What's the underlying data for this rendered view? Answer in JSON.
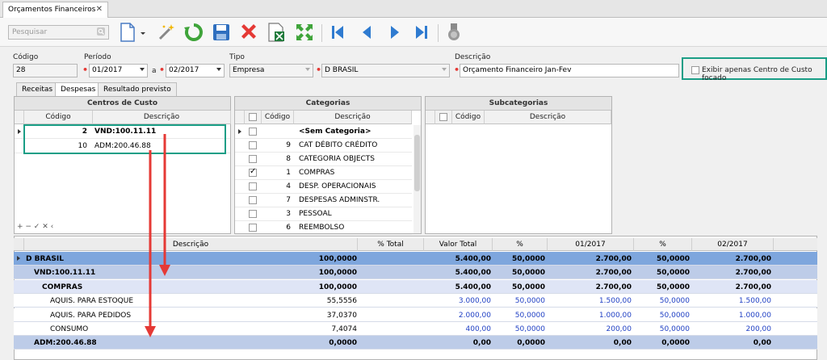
{
  "colors": {
    "accent_highlight": "#1a9e86",
    "arrow": "#e53935",
    "group1_row": "#7ea6dd",
    "group2_row": "#bdcce8",
    "group3_row": "#dfe5f6",
    "blue_values": "#1f3fc4"
  },
  "tab": {
    "title": "Orçamentos Financeiros",
    "close": "✕"
  },
  "toolbar": {
    "search_placeholder": "Pesquisar",
    "icons": [
      "search-icon",
      "new-document-icon",
      "dropdown-arrow-icon",
      "magic-wand-icon",
      "refresh-icon",
      "save-icon",
      "delete-icon",
      "export-excel-icon",
      "expand-icon",
      "first-record-icon",
      "previous-record-icon",
      "next-record-icon",
      "last-record-icon",
      "medal-icon"
    ]
  },
  "form": {
    "codigo": {
      "label": "Código",
      "value": "28"
    },
    "periodo": {
      "label": "Período",
      "from": "01/2017",
      "separator": "a",
      "to": "02/2017"
    },
    "tipo": {
      "label": "Tipo",
      "value": "Empresa"
    },
    "empresa": {
      "value": "D BRASIL"
    },
    "descricao": {
      "label": "Descrição",
      "value": "Orçamento Financeiro Jan-Fev"
    },
    "focus_checkbox": {
      "label": "Exibir apenas Centro de Custo focado",
      "checked": false
    }
  },
  "subtabs": [
    {
      "label": "Receitas",
      "active": false
    },
    {
      "label": "Despesas",
      "active": true
    },
    {
      "label": "Resultado previsto",
      "active": false
    }
  ],
  "centros": {
    "title": "Centros de Custo",
    "headers": [
      "Código",
      "Descrição"
    ],
    "rows": [
      {
        "codigo": "2",
        "descricao": "VND:100.11.11"
      },
      {
        "codigo": "10",
        "descricao": "ADM:200.46.88"
      }
    ],
    "footer": "+ − ✓ ✕ ‹"
  },
  "categorias": {
    "title": "Categorias",
    "headers": [
      "Código",
      "Descrição"
    ],
    "rows": [
      {
        "codigo": "",
        "descricao": "<Sem Categoria>",
        "checked": false
      },
      {
        "codigo": "9",
        "descricao": "CAT DÉBITO CRÉDITO",
        "checked": false
      },
      {
        "codigo": "8",
        "descricao": "CATEGORIA OBJECTS",
        "checked": false
      },
      {
        "codigo": "1",
        "descricao": "COMPRAS",
        "checked": true
      },
      {
        "codigo": "4",
        "descricao": "DESP. OPERACIONAIS",
        "checked": false
      },
      {
        "codigo": "7",
        "descricao": "DESPESAS ADMINSTR.",
        "checked": false
      },
      {
        "codigo": "3",
        "descricao": "PESSOAL",
        "checked": false
      },
      {
        "codigo": "6",
        "descricao": "REEMBOLSO",
        "checked": false
      }
    ]
  },
  "subcategorias": {
    "title": "Subcategorias",
    "headers": [
      "Código",
      "Descrição"
    ]
  },
  "grid": {
    "headers": [
      "Descrição",
      "% Total",
      "Valor Total",
      "%",
      "01/2017",
      "%",
      "02/2017"
    ],
    "rows": [
      {
        "descricao": "D BRASIL",
        "pct_total": "100,0000",
        "valor_total": "5.400,00",
        "pct1": "50,0000",
        "v1": "2.700,00",
        "pct2": "50,0000",
        "v2": "2.700,00"
      },
      {
        "descricao": "VND:100.11.11",
        "pct_total": "100,0000",
        "valor_total": "5.400,00",
        "pct1": "50,0000",
        "v1": "2.700,00",
        "pct2": "50,0000",
        "v2": "2.700,00"
      },
      {
        "descricao": "COMPRAS",
        "pct_total": "100,0000",
        "valor_total": "5.400,00",
        "pct1": "50,0000",
        "v1": "2.700,00",
        "pct2": "50,0000",
        "v2": "2.700,00"
      },
      {
        "descricao": "AQUIS. PARA ESTOQUE",
        "pct_total": "55,5556",
        "valor_total": "3.000,00",
        "pct1": "50,0000",
        "v1": "1.500,00",
        "pct2": "50,0000",
        "v2": "1.500,00"
      },
      {
        "descricao": "AQUIS. PARA PEDIDOS",
        "pct_total": "37,0370",
        "valor_total": "2.000,00",
        "pct1": "50,0000",
        "v1": "1.000,00",
        "pct2": "50,0000",
        "v2": "1.000,00"
      },
      {
        "descricao": "CONSUMO",
        "pct_total": "7,4074",
        "valor_total": "400,00",
        "pct1": "50,0000",
        "v1": "200,00",
        "pct2": "50,0000",
        "v2": "200,00"
      },
      {
        "descricao": "ADM:200.46.88",
        "pct_total": "0,0000",
        "valor_total": "0,00",
        "pct1": "0,0000",
        "v1": "0,00",
        "pct2": "0,0000",
        "v2": "0,00"
      }
    ]
  }
}
